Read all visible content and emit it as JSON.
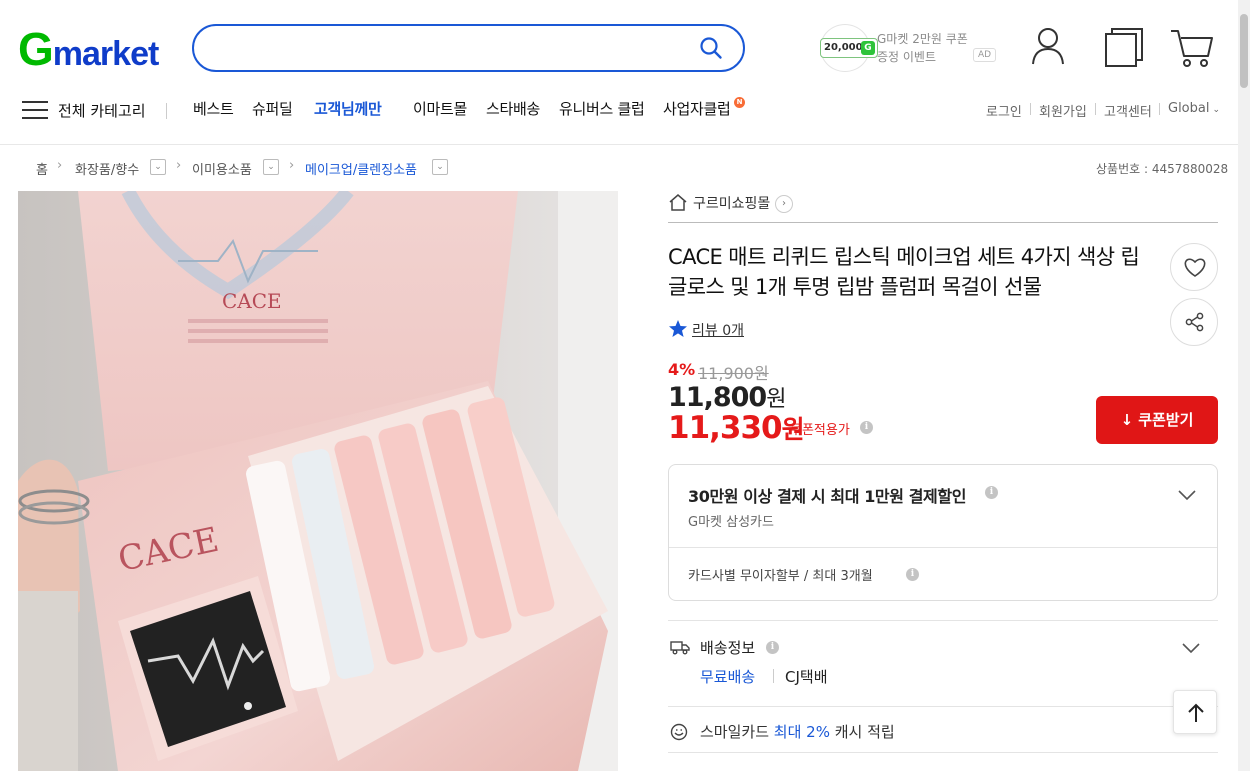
{
  "header": {
    "logo_g": "G",
    "logo_rest": "market",
    "search_placeholder": "",
    "ad": {
      "chip_amount": "20,000",
      "chip_badge": "G",
      "line1": "G마켓 2만원 쿠폰",
      "line2": "증정 이벤트",
      "badge": "AD"
    }
  },
  "gnb": {
    "all_categories": "전체 카테고리",
    "items": [
      "베스트",
      "슈퍼딜",
      "고객님께만",
      "이마트몰",
      "스타배송",
      "유니버스 클럽",
      "사업자클럽"
    ],
    "active_index": 2,
    "new_badge": "N",
    "util": [
      "로그인",
      "회원가입",
      "고객센터",
      "Global"
    ]
  },
  "breadcrumb": {
    "items": [
      "홈",
      "화장품/향수",
      "이미용소품",
      "메이크업/클렌징소품"
    ],
    "product_no": "상품번호 : 4457880028"
  },
  "product": {
    "shop_name": "구르미쇼핑몰",
    "title": "CACE 매트 리퀴드 립스틱 메이크업 세트 4가지 색상 립글로스 및 1개 투명 립밤 플럼퍼 목걸이 선물",
    "review": "리뷰 0개",
    "discount": "4%",
    "original_price": "11,900원",
    "price": "11,800",
    "price_unit": "원",
    "coupon_price": "11,330",
    "coupon_apply": "쿠폰적용가",
    "coupon_button": "쿠폰받기",
    "image_brand": "CACE"
  },
  "card": {
    "title": "30만원 이상 결제 시 최대 1만원 결제할인",
    "sub": "G마켓 삼성카드",
    "installment": "카드사별 무이자할부 / 최대 3개월"
  },
  "shipping": {
    "label": "배송정보",
    "free": "무료배송",
    "company": "CJ택배"
  },
  "smile": {
    "prefix": "스마일카드",
    "highlight": "최대 2%",
    "suffix": "캐시 적립"
  },
  "colors": {
    "brand_green": "#00b900",
    "brand_blue": "#0f3cc9",
    "accent_blue": "#1a58d6",
    "sale_red": "#e51a1a"
  }
}
